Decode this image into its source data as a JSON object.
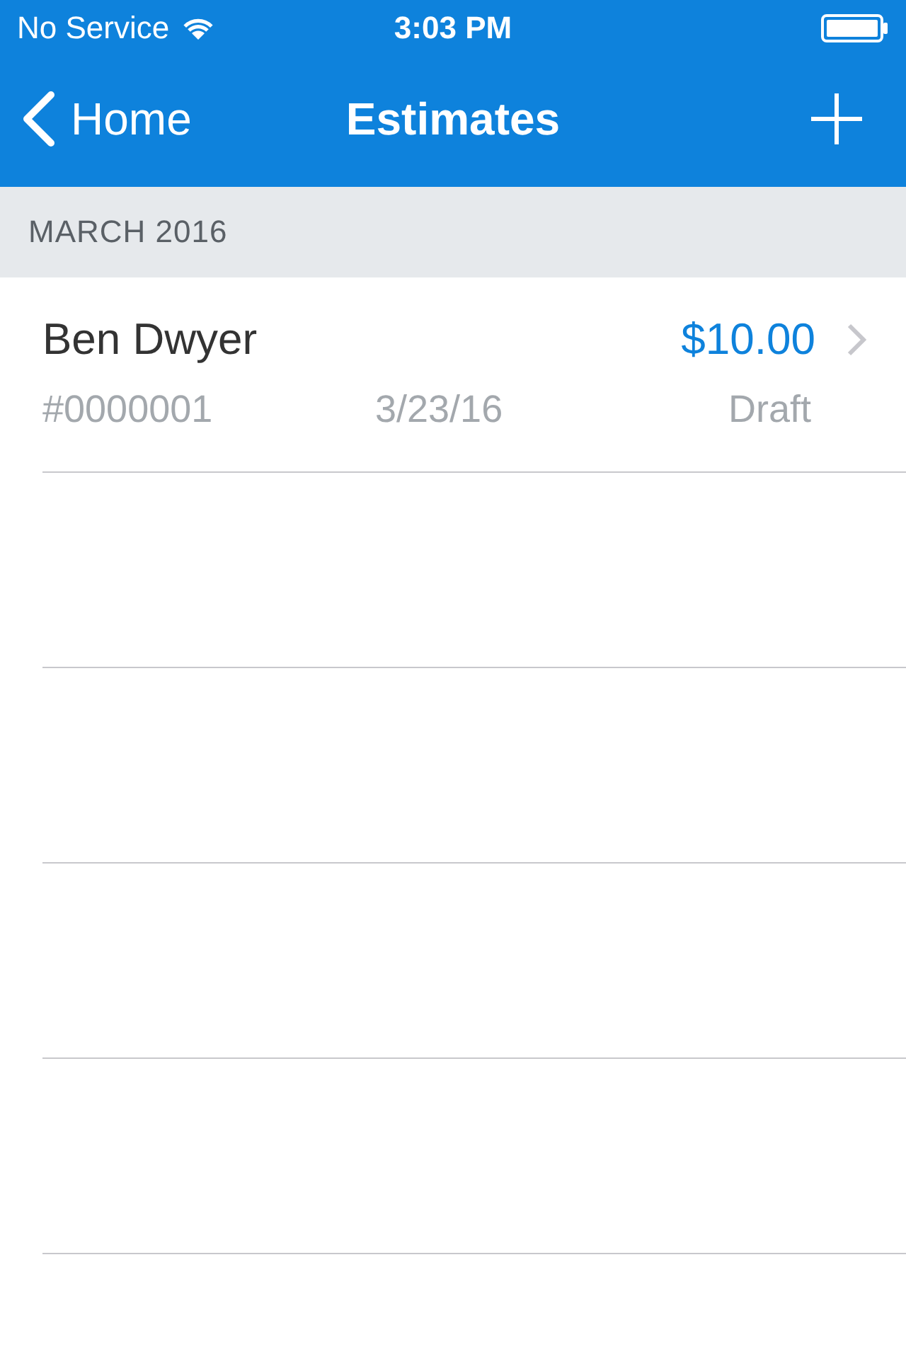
{
  "status_bar": {
    "carrier": "No Service",
    "time": "3:03 PM"
  },
  "nav": {
    "back_label": "Home",
    "title": "Estimates"
  },
  "sections": [
    {
      "header": "MARCH 2016",
      "rows": [
        {
          "name": "Ben Dwyer",
          "amount": "$10.00",
          "number": "#0000001",
          "date": "3/23/16",
          "status": "Draft"
        }
      ]
    }
  ]
}
